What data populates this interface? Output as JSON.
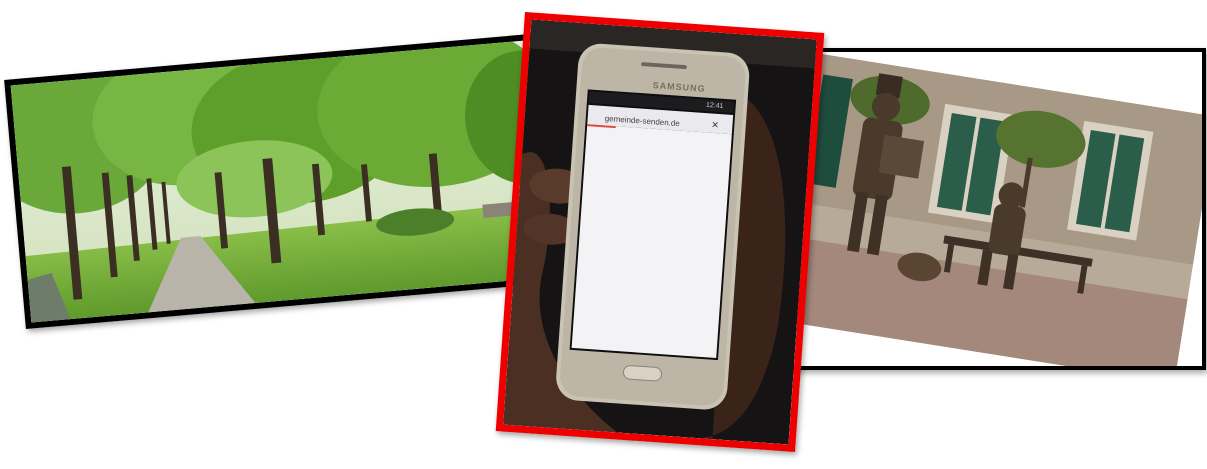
{
  "photos": [
    {
      "subject": "park-avenue",
      "border_color": "#000000"
    },
    {
      "subject": "phone-in-hand",
      "border_color": "#ee0000"
    },
    {
      "subject": "bronze-statues",
      "border_color": "#000000"
    }
  ],
  "phone": {
    "brand": "SAMSUNG",
    "url": "gemeinde-senden.de",
    "close_glyph": "×",
    "clock": "12:41"
  },
  "colors": {
    "grass": "#7fb53a",
    "foliage": "#5e9e2a",
    "path": "#b9b4aa",
    "red_frame": "#ee0000",
    "bronze": "#4a3a2c"
  }
}
